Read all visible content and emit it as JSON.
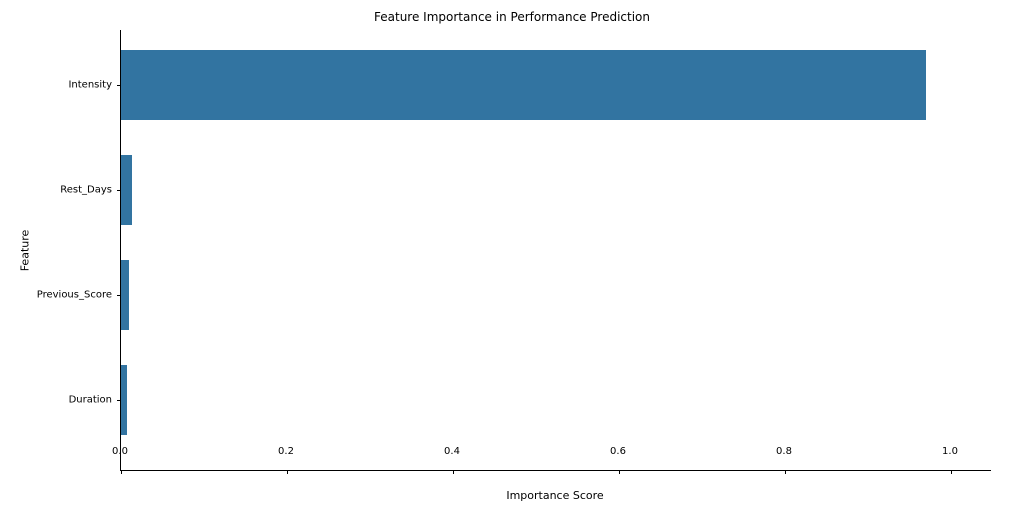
{
  "chart_data": {
    "type": "bar",
    "orientation": "horizontal",
    "title": "Feature Importance in Performance Prediction",
    "xlabel": "Importance Score",
    "ylabel": "Feature",
    "xlim": [
      0,
      1.0
    ],
    "xticks": [
      {
        "v": 0.0,
        "label": "0.0"
      },
      {
        "v": 0.2,
        "label": "0.2"
      },
      {
        "v": 0.4,
        "label": "0.4"
      },
      {
        "v": 0.6,
        "label": "0.6"
      },
      {
        "v": 0.8,
        "label": "0.8"
      },
      {
        "v": 1.0,
        "label": "1.0"
      }
    ],
    "categories": [
      "Intensity",
      "Rest_Days",
      "Previous_Score",
      "Duration"
    ],
    "values": [
      0.97,
      0.013,
      0.01,
      0.007
    ],
    "bar_color": "#3274a1"
  }
}
